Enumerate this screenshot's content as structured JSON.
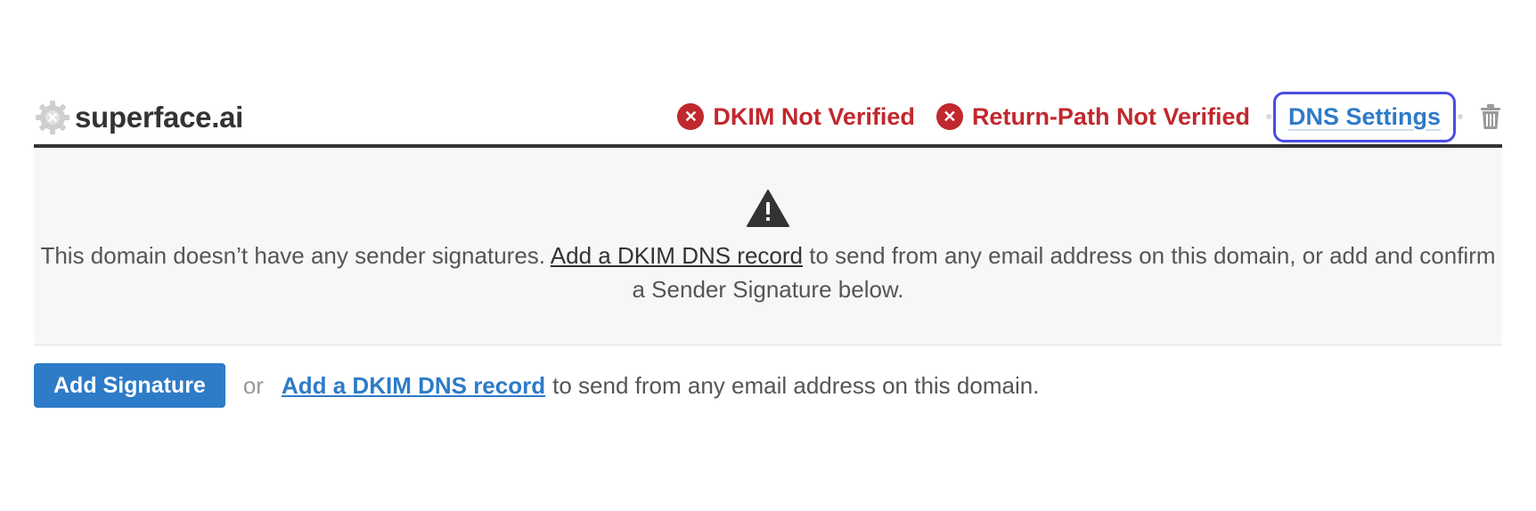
{
  "domain": {
    "name": "superface.ai",
    "icon": "gear-icon"
  },
  "status": {
    "dkim_label": "DKIM Not Verified",
    "return_path_label": "Return-Path Not Verified",
    "error_icon": "x-circle-icon",
    "error_color": "#c0282d"
  },
  "header_actions": {
    "dns_settings_label": "DNS Settings",
    "delete_icon": "trash-icon",
    "link_color": "#2e7bc8",
    "focus_color": "#4b4de3"
  },
  "notice": {
    "icon": "warning-icon",
    "text_before": "This domain doesn’t have any sender signatures. ",
    "link_label": "Add a DKIM DNS record",
    "text_after": " to send from any email address on this domain, or add and confirm a Sender Signature below."
  },
  "actions": {
    "add_signature_label": "Add Signature",
    "or_label": "or",
    "dkim_link_label": "Add a DKIM DNS record",
    "after_link_text": "to send from any email address on this domain."
  }
}
